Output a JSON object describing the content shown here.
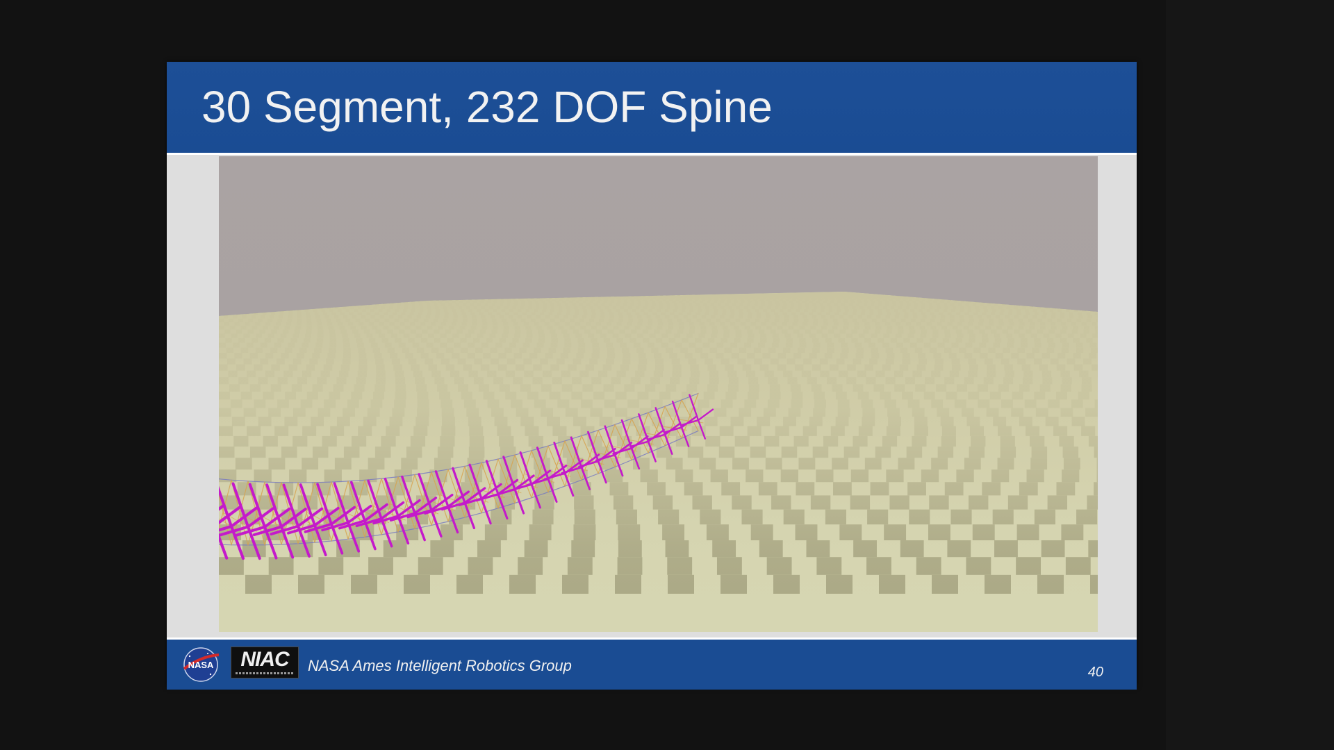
{
  "slide": {
    "title": "30 Segment, 232 DOF Spine",
    "footer": {
      "organization": "NASA Ames Intelligent Robotics Group",
      "page_number": "40",
      "logos": [
        {
          "name": "nasa-logo",
          "text": "NASA"
        },
        {
          "name": "niac-logo",
          "text": "NIAC"
        }
      ]
    }
  },
  "colors": {
    "header_blue": "#1a4c93",
    "sky": "#a8a2a1",
    "ground_light": "#d8d8b4",
    "ground_dark": "#a9a784",
    "strut_magenta": "#c41aca",
    "cable_orange": "#d6a350",
    "cable_blue": "#7477c2"
  },
  "simulation": {
    "scene": "tensegrity-spine-simulation",
    "segments": 30,
    "degrees_of_freedom": 232
  }
}
